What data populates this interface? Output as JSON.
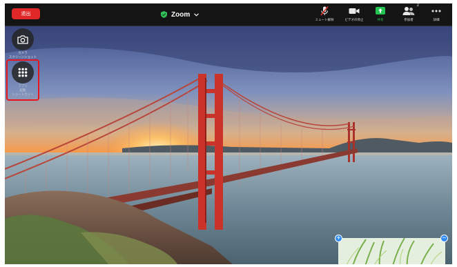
{
  "toolbar": {
    "leave_label": "退出",
    "meeting_title": "Zoom",
    "items": [
      {
        "icon": "mic-muted-icon",
        "label": "ミュート解除"
      },
      {
        "icon": "video-camera-icon",
        "label": "ビデオの停止"
      },
      {
        "icon": "share-screen-icon",
        "label": "共有"
      },
      {
        "icon": "participants-icon",
        "label": "参加者",
        "count": "2"
      },
      {
        "icon": "more-icon",
        "label": "詳細"
      }
    ]
  },
  "side_apps": [
    {
      "icon": "camera-icon",
      "label_lines": [
        "カメラ",
        "スクリーンショット"
      ]
    },
    {
      "icon": "apps-grid-icon",
      "label_lines": [
        "アプリ",
        "起動",
        "ショートカット"
      ]
    }
  ],
  "colors": {
    "leave_red": "#e02828",
    "share_green": "#23c552",
    "highlight_red": "#e8141c",
    "shield_green": "#33c05a",
    "control_blue": "#2f8bf5"
  }
}
